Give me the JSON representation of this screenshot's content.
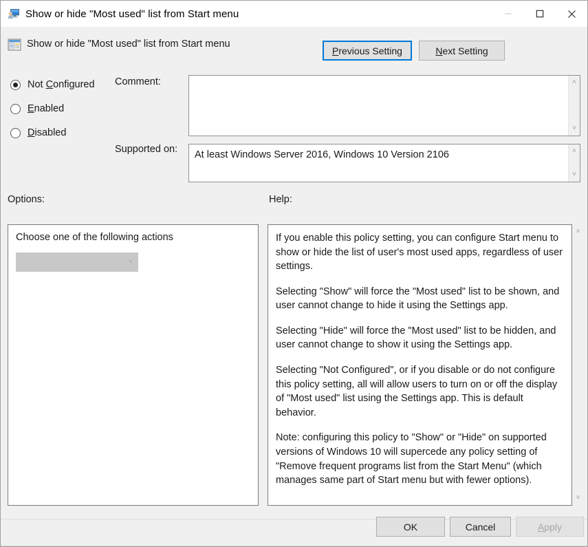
{
  "window": {
    "title": "Show or hide \"Most used\" list from Start menu",
    "icon": "computer-user-icon",
    "controls": {
      "minimize": "minimize-icon",
      "maximize": "maximize-icon",
      "close": "close-icon"
    }
  },
  "header": {
    "policy_icon": "policy-setting-icon",
    "policy_name": "Show or hide \"Most used\" list from Start menu",
    "previous_setting": {
      "prefix": "",
      "accel": "P",
      "suffix": "revious Setting",
      "focused": true
    },
    "next_setting": {
      "prefix": "",
      "accel": "N",
      "suffix": "ext Setting",
      "focused": false
    }
  },
  "state_options": [
    {
      "label_before": "Not ",
      "accel": "C",
      "label_after": "onfigured",
      "selected": true
    },
    {
      "label_before": "",
      "accel": "E",
      "label_after": "nabled",
      "selected": false
    },
    {
      "label_before": "",
      "accel": "D",
      "label_after": "isabled",
      "selected": false
    }
  ],
  "comment": {
    "label": "Comment:",
    "value": "",
    "placeholder": ""
  },
  "supported_on": {
    "label": "Supported on:",
    "value": "At least Windows Server 2016, Windows 10 Version 2106"
  },
  "options": {
    "label": "Options:",
    "caption": "Choose one of the following actions",
    "dropdown_value": "",
    "dropdown_enabled": false,
    "chevron": "chevron-down-icon"
  },
  "help": {
    "label": "Help:",
    "paragraphs": [
      "If you enable this policy setting, you can configure Start menu to show or hide the list of user's most used apps, regardless of user settings.",
      "Selecting \"Show\" will force the \"Most used\" list to be shown, and user cannot change to hide it using the Settings app.",
      "Selecting \"Hide\" will force the \"Most used\" list to be hidden, and user cannot change to show it using the Settings app.",
      "Selecting \"Not Configured\", or if you disable or do not configure this policy setting, all will allow users to turn on or off the display of \"Most used\" list using the Settings app. This is default behavior.",
      "Note: configuring this policy to \"Show\" or \"Hide\" on supported versions of Windows 10 will supercede any policy setting of \"Remove frequent programs list from the Start Menu\" (which manages same part of Start menu but with fewer options)."
    ]
  },
  "scrollbars": {
    "up_glyph": "˄",
    "down_glyph": "˅"
  },
  "footer": {
    "ok": "OK",
    "cancel": "Cancel",
    "apply": {
      "accel": "A",
      "rest": "pply",
      "enabled": false
    }
  },
  "colors": {
    "window_bg": "#f0f0f0",
    "titlebar_bg": "#ffffff",
    "focus_border": "#0078d7",
    "button_face": "#e1e1e1",
    "disabled_combo": "#c8c8c8",
    "text": "#1a1a1a"
  }
}
